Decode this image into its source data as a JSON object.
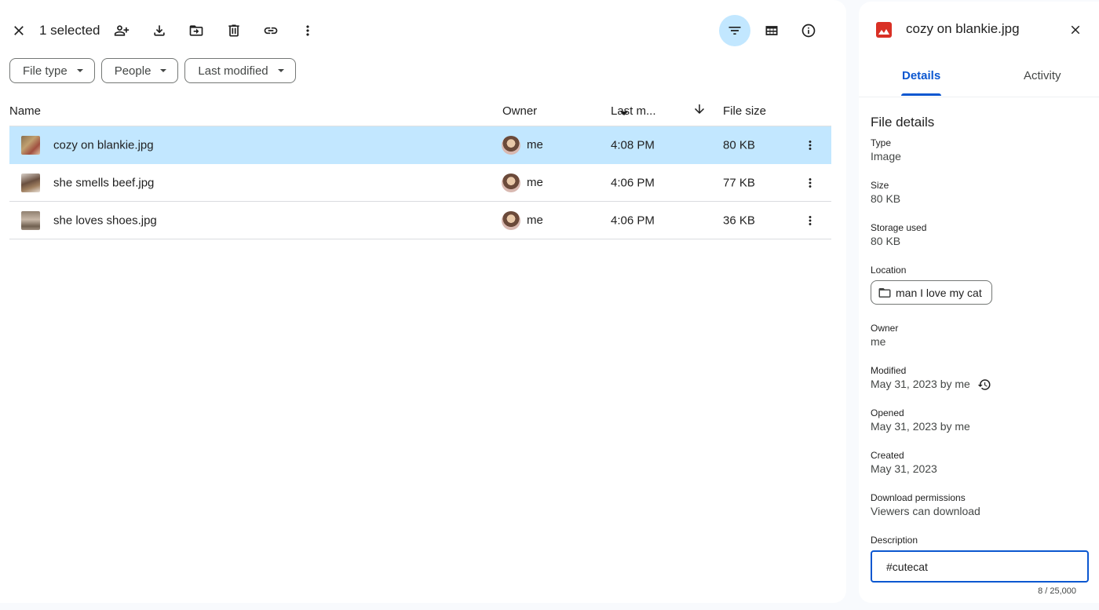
{
  "toolbar": {
    "selected_count": "1 selected",
    "icons": [
      "close-icon",
      "share-icon",
      "download-icon",
      "move-icon",
      "trash-icon",
      "link-icon",
      "more-vert-icon"
    ],
    "right_icons": [
      "filter-icon",
      "grid-view-icon",
      "info-icon"
    ]
  },
  "filters": [
    {
      "label": "File type"
    },
    {
      "label": "People"
    },
    {
      "label": "Last modified"
    }
  ],
  "table": {
    "columns": {
      "name": "Name",
      "owner": "Owner",
      "modified": "Last m...",
      "size": "File size"
    },
    "sort_direction": "descending",
    "rows": [
      {
        "name": "cozy on blankie.jpg",
        "owner": "me",
        "modified": "4:08 PM",
        "size": "80 KB",
        "selected": true
      },
      {
        "name": "she smells beef.jpg",
        "owner": "me",
        "modified": "4:06 PM",
        "size": "77 KB",
        "selected": false
      },
      {
        "name": "she loves shoes.jpg",
        "owner": "me",
        "modified": "4:06 PM",
        "size": "36 KB",
        "selected": false
      }
    ]
  },
  "details": {
    "title": "cozy on blankie.jpg",
    "tabs": {
      "details": "Details",
      "activity": "Activity"
    },
    "active_tab": "Details",
    "section_title": "File details",
    "fields": {
      "type": {
        "label": "Type",
        "value": "Image"
      },
      "size": {
        "label": "Size",
        "value": "80 KB"
      },
      "storage": {
        "label": "Storage used",
        "value": "80 KB"
      },
      "location": {
        "label": "Location",
        "value": "man I love my cat"
      },
      "owner": {
        "label": "Owner",
        "value": "me"
      },
      "modified": {
        "label": "Modified",
        "value": "May 31, 2023 by me"
      },
      "opened": {
        "label": "Opened",
        "value": "May 31, 2023 by me"
      },
      "created": {
        "label": "Created",
        "value": "May 31, 2023"
      },
      "download": {
        "label": "Download permissions",
        "value": "Viewers can download"
      },
      "description": {
        "label": "Description",
        "value": "#cutecat",
        "count": "8 / 25,000"
      }
    }
  },
  "colors": {
    "accent": "#0b57d0",
    "selection": "#c2e7ff",
    "image_icon": "#d93025",
    "background": "#f8fafd"
  }
}
